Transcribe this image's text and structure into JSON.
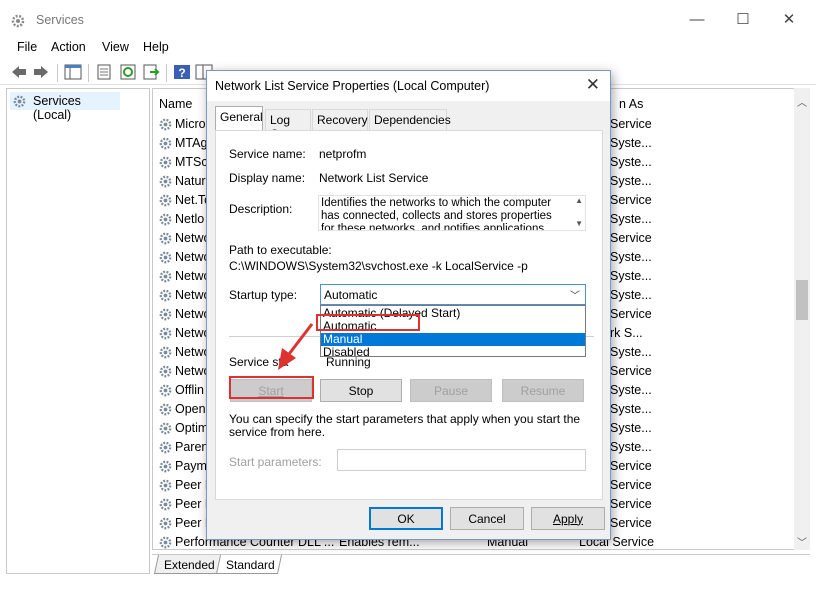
{
  "window": {
    "title": "Services"
  },
  "menu": [
    "File",
    "Action",
    "View",
    "Help"
  ],
  "tree": {
    "root_label": "Services (Local)"
  },
  "list": {
    "col_name": "Name",
    "col_logon": "n As",
    "rows": [
      {
        "name": "Micro",
        "logon": "Service"
      },
      {
        "name": "MTAg",
        "logon": "Syste..."
      },
      {
        "name": "MTSc",
        "logon": "Syste..."
      },
      {
        "name": "Natur",
        "logon": "Syste..."
      },
      {
        "name": "Net.Tc",
        "logon": "Service"
      },
      {
        "name": "Netlo",
        "logon": "Syste..."
      },
      {
        "name": "Netwo",
        "logon": "Service"
      },
      {
        "name": "Netwo",
        "logon": "Syste..."
      },
      {
        "name": "Netwo",
        "logon": "Syste..."
      },
      {
        "name": "Netwo",
        "logon": "Syste..."
      },
      {
        "name": "Netwo",
        "logon": "Service"
      },
      {
        "name": "Netwo",
        "logon": "rk S..."
      },
      {
        "name": "Netwo",
        "logon": "Syste..."
      },
      {
        "name": "Netwo",
        "logon": "Service"
      },
      {
        "name": "Offlin",
        "logon": "Syste..."
      },
      {
        "name": "OpenS",
        "logon": "Syste..."
      },
      {
        "name": "Optim",
        "logon": "Syste..."
      },
      {
        "name": "Parent",
        "logon": "Syste..."
      },
      {
        "name": "Paym",
        "logon": "Service"
      },
      {
        "name": "Peer N",
        "logon": "Service"
      },
      {
        "name": "Peer N",
        "logon": "Service"
      },
      {
        "name": "Peer N",
        "logon": "Service"
      }
    ],
    "last_row": {
      "name": "Performance Counter DLL ...",
      "desc": "Enables rem...",
      "startup": "Manual",
      "logon": "Local Service"
    }
  },
  "bottom_tabs": {
    "extended": "Extended",
    "standard": "Standard"
  },
  "dialog": {
    "title": "Network List Service Properties (Local Computer)",
    "tabs": [
      "General",
      "Log On",
      "Recovery",
      "Dependencies"
    ],
    "service_name_label": "Service name:",
    "service_name": "netprofm",
    "display_name_label": "Display name:",
    "display_name": "Network List Service",
    "description_label": "Description:",
    "description": "Identifies the networks to which the computer has connected, collects and stores properties for these networks, and notifies applications when these",
    "path_label": "Path to executable:",
    "path": "C:\\WINDOWS\\System32\\svchost.exe -k LocalService -p",
    "startup_type_label": "Startup type:",
    "startup_type": "Automatic",
    "startup_options": [
      "Automatic (Delayed Start)",
      "Automatic",
      "Manual",
      "Disabled"
    ],
    "service_status_label": "Service sta",
    "service_status": "Running",
    "start_label": "Start",
    "stop_label": "Stop",
    "pause_label": "Pause",
    "resume_label": "Resume",
    "hint": "You can specify the start parameters that apply when you start the service from here.",
    "start_params_label": "Start parameters:",
    "ok_label": "OK",
    "cancel_label": "Cancel",
    "apply_label": "Apply"
  },
  "colors": {
    "highlight": "#0078d7",
    "annotation": "#e03131"
  }
}
